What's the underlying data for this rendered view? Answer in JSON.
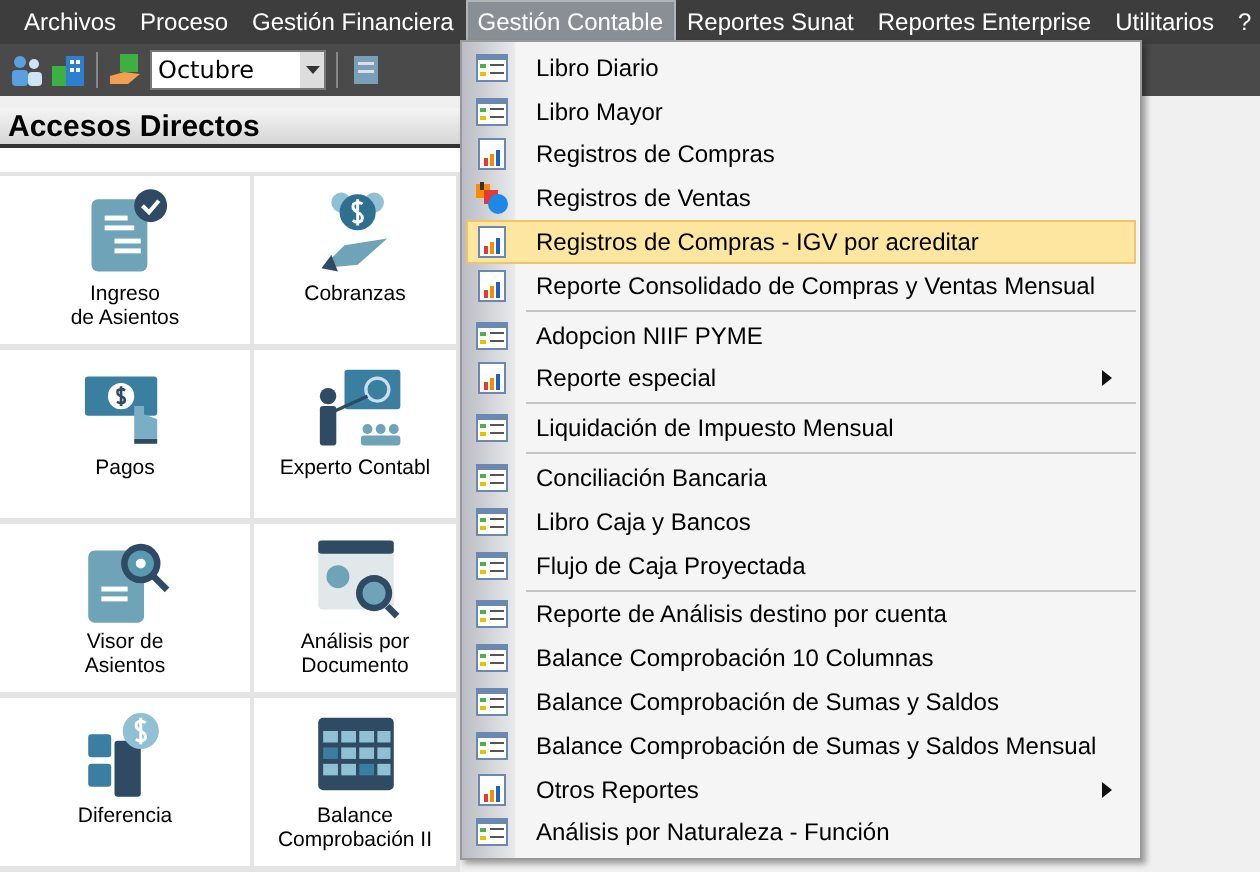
{
  "menubar": [
    {
      "label": "Archivos",
      "selected": false
    },
    {
      "label": "Proceso",
      "selected": false
    },
    {
      "label": "Gestión Financiera",
      "selected": false
    },
    {
      "label": "Gestión Contable",
      "selected": true
    },
    {
      "label": "Reportes Sunat",
      "selected": false
    },
    {
      "label": "Reportes Enterprise",
      "selected": false
    },
    {
      "label": "Utilitarios",
      "selected": false
    },
    {
      "label": "?",
      "selected": false
    }
  ],
  "toolbar": {
    "month_dropdown": {
      "value": "Octubre"
    }
  },
  "panel": {
    "title": "Accesos Directos",
    "tiles": [
      {
        "label": "Ingreso\nde Asientos"
      },
      {
        "label": "Cobranzas"
      },
      {
        "label": "Pagos"
      },
      {
        "label": "Experto Contabl"
      },
      {
        "label": "Visor de\nAsientos"
      },
      {
        "label": "Análisis por\nDocumento"
      },
      {
        "label": "Diferencia"
      },
      {
        "label": "Balance Comprobación II"
      }
    ]
  },
  "dropdown_menu": {
    "groups": [
      [
        {
          "label": "Libro Diario",
          "kind": "grid",
          "selected": false,
          "submenu": false
        },
        {
          "label": "Libro Mayor",
          "kind": "grid",
          "selected": false,
          "submenu": false
        },
        {
          "label": "Registros de Compras",
          "kind": "chart",
          "selected": false,
          "submenu": false
        },
        {
          "label": "Registros de Ventas",
          "kind": "multi",
          "selected": false,
          "submenu": false
        },
        {
          "label": "Registros de Compras - IGV por acreditar",
          "kind": "chart",
          "selected": true,
          "submenu": false
        },
        {
          "label": "Reporte Consolidado de Compras y Ventas Mensual",
          "kind": "chart",
          "selected": false,
          "submenu": false
        }
      ],
      [
        {
          "label": "Adopcion NIIF PYME",
          "kind": "grid",
          "selected": false,
          "submenu": false
        },
        {
          "label": "Reporte especial",
          "kind": "chart",
          "selected": false,
          "submenu": true
        }
      ],
      [
        {
          "label": "Liquidación de Impuesto Mensual",
          "kind": "grid",
          "selected": false,
          "submenu": false
        }
      ],
      [
        {
          "label": "Conciliación Bancaria",
          "kind": "grid",
          "selected": false,
          "submenu": false
        },
        {
          "label": "Libro Caja y Bancos",
          "kind": "grid",
          "selected": false,
          "submenu": false
        },
        {
          "label": "Flujo de Caja Proyectada",
          "kind": "grid",
          "selected": false,
          "submenu": false
        }
      ],
      [
        {
          "label": "Reporte de Análisis destino por cuenta",
          "kind": "grid",
          "selected": false,
          "submenu": false
        },
        {
          "label": "Balance Comprobación 10 Columnas",
          "kind": "grid",
          "selected": false,
          "submenu": false
        },
        {
          "label": "Balance Comprobación de Sumas y Saldos",
          "kind": "grid",
          "selected": false,
          "submenu": false
        },
        {
          "label": "Balance Comprobación de Sumas y Saldos Mensual",
          "kind": "grid",
          "selected": false,
          "submenu": false
        },
        {
          "label": "Otros Reportes",
          "kind": "chart",
          "selected": false,
          "submenu": true
        },
        {
          "label": "Análisis por Naturaleza - Función",
          "kind": "grid",
          "selected": false,
          "submenu": false
        }
      ]
    ]
  }
}
